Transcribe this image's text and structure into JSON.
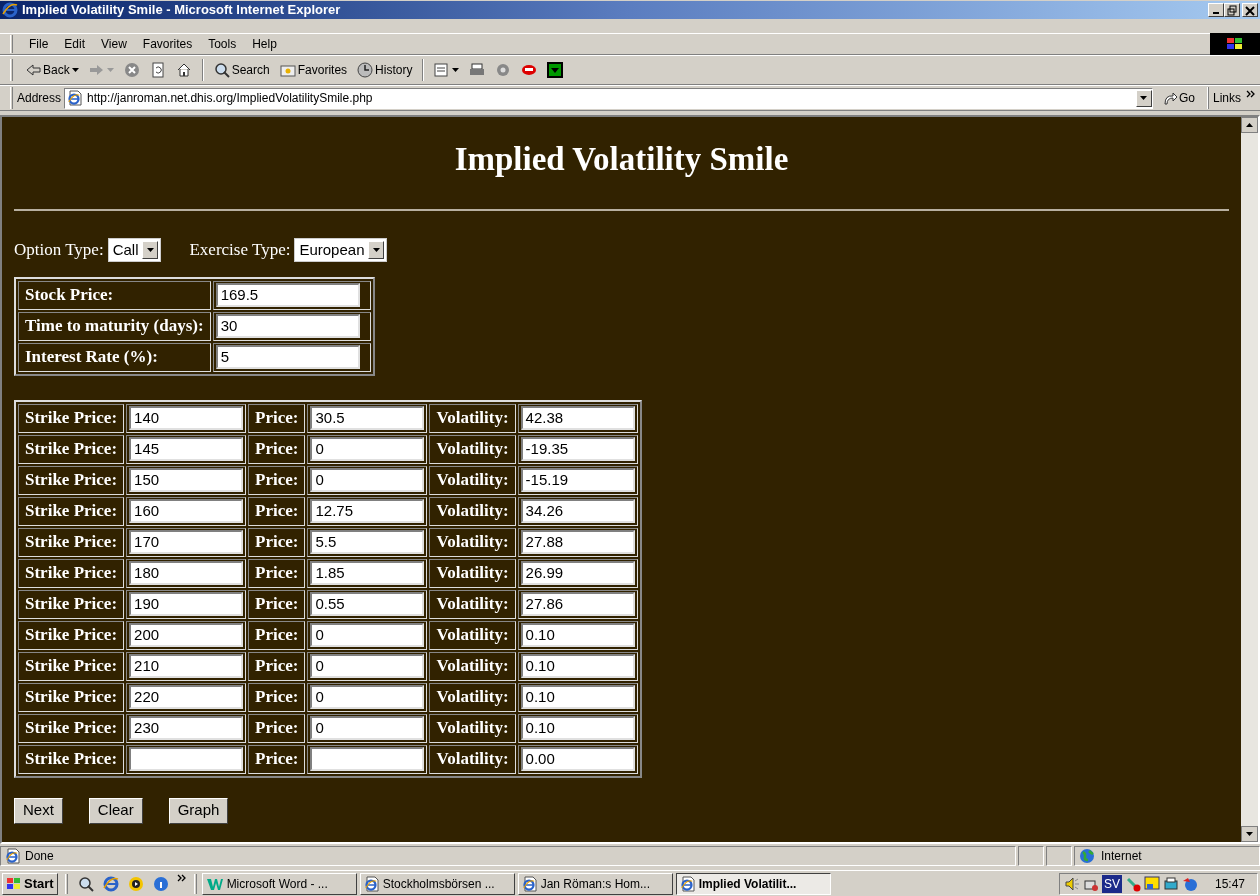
{
  "window": {
    "title": "Implied Volatility Smile - Microsoft Internet Explorer"
  },
  "menu": [
    "File",
    "Edit",
    "View",
    "Favorites",
    "Tools",
    "Help"
  ],
  "toolbar": [
    {
      "kind": "back",
      "label": "Back"
    },
    {
      "kind": "forward"
    },
    {
      "kind": "stop"
    },
    {
      "kind": "refresh"
    },
    {
      "kind": "home"
    },
    {
      "kind": "search",
      "label": "Search"
    },
    {
      "kind": "favorites",
      "label": "Favorites"
    },
    {
      "kind": "history",
      "label": "History"
    },
    {
      "kind": "mail"
    },
    {
      "kind": "print"
    },
    {
      "kind": "gear"
    },
    {
      "kind": "badge"
    },
    {
      "kind": "download"
    }
  ],
  "address": {
    "label": "Address",
    "url": "http://janroman.net.dhis.org/ImpliedVolatilitySmile.php",
    "go": "Go",
    "links": "Links"
  },
  "page": {
    "title": "Implied Volatility Smile",
    "selects": [
      {
        "label": "Option Type:",
        "value": "Call"
      },
      {
        "label": "Exercise Type:",
        "value": "European"
      }
    ],
    "params": [
      {
        "label": "Stock Price:",
        "value": "169.5"
      },
      {
        "label": "Time to maturity (days):",
        "value": "30"
      },
      {
        "label": "Interest Rate (%):",
        "value": "5"
      }
    ],
    "rows": [
      {
        "strike_label": "Strike Price:",
        "strike": "140",
        "price_label": "Price:",
        "price": "30.5",
        "vol_label": "Volatility:",
        "volatility": "42.38"
      },
      {
        "strike_label": "Strike Price:",
        "strike": "145",
        "price_label": "Price:",
        "price": "0",
        "vol_label": "Volatility:",
        "volatility": "-19.35"
      },
      {
        "strike_label": "Strike Price:",
        "strike": "150",
        "price_label": "Price:",
        "price": "0",
        "vol_label": "Volatility:",
        "volatility": "-15.19"
      },
      {
        "strike_label": "Strike Price:",
        "strike": "160",
        "price_label": "Price:",
        "price": "12.75",
        "vol_label": "Volatility:",
        "volatility": "34.26"
      },
      {
        "strike_label": "Strike Price:",
        "strike": "170",
        "price_label": "Price:",
        "price": "5.5",
        "vol_label": "Volatility:",
        "volatility": "27.88"
      },
      {
        "strike_label": "Strike Price:",
        "strike": "180",
        "price_label": "Price:",
        "price": "1.85",
        "vol_label": "Volatility:",
        "volatility": "26.99"
      },
      {
        "strike_label": "Strike Price:",
        "strike": "190",
        "price_label": "Price:",
        "price": "0.55",
        "vol_label": "Volatility:",
        "volatility": "27.86"
      },
      {
        "strike_label": "Strike Price:",
        "strike": "200",
        "price_label": "Price:",
        "price": "0",
        "vol_label": "Volatility:",
        "volatility": "0.10"
      },
      {
        "strike_label": "Strike Price:",
        "strike": "210",
        "price_label": "Price:",
        "price": "0",
        "vol_label": "Volatility:",
        "volatility": "0.10"
      },
      {
        "strike_label": "Strike Price:",
        "strike": "220",
        "price_label": "Price:",
        "price": "0",
        "vol_label": "Volatility:",
        "volatility": "0.10"
      },
      {
        "strike_label": "Strike Price:",
        "strike": "230",
        "price_label": "Price:",
        "price": "0",
        "vol_label": "Volatility:",
        "volatility": "0.10"
      },
      {
        "strike_label": "Strike Price:",
        "price_label": "Price:",
        "vol_label": "Volatility:",
        "volatility": "0.00"
      }
    ],
    "buttons": [
      "Next",
      "Clear",
      "Graph"
    ]
  },
  "status": {
    "text": "Done",
    "zone": "Internet"
  },
  "taskbar": {
    "start": "Start",
    "tasks": [
      {
        "label": "Microsoft Word - ...",
        "kind": "word",
        "selected": false
      },
      {
        "label": "Stockholmsbörsen ...",
        "kind": "ie",
        "selected": false
      },
      {
        "label": "Jan Röman:s Hom...",
        "kind": "ie",
        "selected": false
      },
      {
        "label": "Implied Volatilit...",
        "kind": "ie",
        "selected": true
      }
    ],
    "tray_lang": "SV",
    "clock": "15:47"
  }
}
